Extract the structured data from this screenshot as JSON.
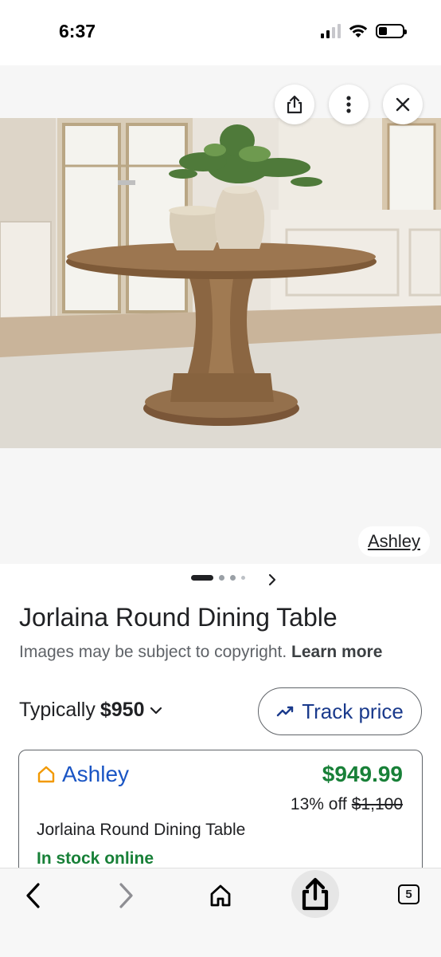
{
  "status_bar": {
    "time": "6:37"
  },
  "image_viewer": {
    "source_label": "Ashley",
    "image_alt": "Round wooden pedestal dining table with vases",
    "carousel_dots": 4,
    "active_dot": 1
  },
  "product": {
    "title": "Jorlaina Round Dining Table",
    "copyright_text": "Images may be subject to copyright.",
    "learn_more_label": "Learn more",
    "typically_prefix": "Typically",
    "typical_price": "$950",
    "track_price_label": "Track price"
  },
  "offer": {
    "merchant": "Ashley",
    "price": "$949.99",
    "discount_text": "13% off",
    "original_price": "$1,100",
    "name": "Jorlaina Round Dining Table",
    "stock": "In stock online"
  },
  "bottom_bar": {
    "tab_count": "5"
  },
  "colors": {
    "accent_blue": "#1a55c4",
    "price_green": "#188038",
    "merchant_icon_orange": "#f29900"
  },
  "icons": [
    "share-icon",
    "more-vert-icon",
    "close-icon",
    "chevron-right-icon",
    "chevron-down-icon",
    "trending-icon",
    "home-icon",
    "back-icon",
    "forward-icon",
    "tabs-icon"
  ]
}
